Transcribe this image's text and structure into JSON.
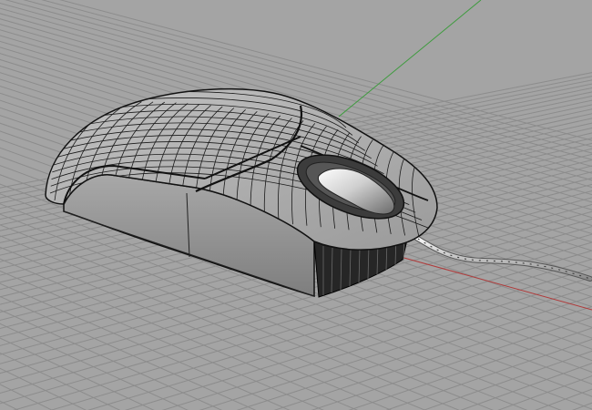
{
  "viewport": {
    "view": "perspective",
    "display_mode": "wireframe-shaded",
    "background_color": "#a4a4a4",
    "grid": {
      "visible": true,
      "line_color": "#8c8c8c",
      "major_line_color": "#7d7d7d"
    },
    "axes": {
      "x_axis_color": "#b03a3a",
      "y_axis_color": "#3d9b3d"
    }
  },
  "model": {
    "object": "computer-mouse",
    "has_scroll_wheel": true,
    "has_cable": true,
    "surface_color": "#aaaaaa",
    "side_color": "#8f8f8f",
    "isocurve_color": "#111111"
  }
}
